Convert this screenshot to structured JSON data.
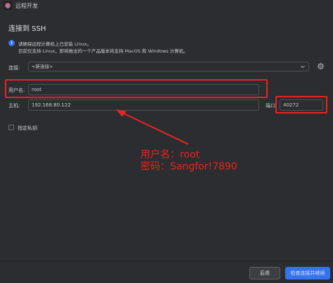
{
  "window": {
    "title": "远程开发"
  },
  "heading": "连接到 SSH",
  "info": {
    "line1": "请确保远程计算机上已安装 Linux。",
    "line2": "目前仅支持 Linux，即将推出的一个产品版本将支持 MacOS 和 Windows 计算机。"
  },
  "connection": {
    "label": "连接:",
    "value": "<新连接>"
  },
  "username": {
    "label": "用户名:",
    "value": "root"
  },
  "host": {
    "label": "主机:",
    "value": "192.168.80.122"
  },
  "port": {
    "label": "端口",
    "value": "40272"
  },
  "private_key": {
    "label": "指定私钥",
    "checked": false
  },
  "annotation": {
    "line1": "用户名：root",
    "line2": "密码：Sangfor!7890",
    "color": "#e8251e"
  },
  "buttons": {
    "back": "后退",
    "check": "检查连接并继续"
  },
  "colors": {
    "background": "#2b2d30",
    "accent": "#3574f0",
    "highlight": "#e8251e"
  }
}
